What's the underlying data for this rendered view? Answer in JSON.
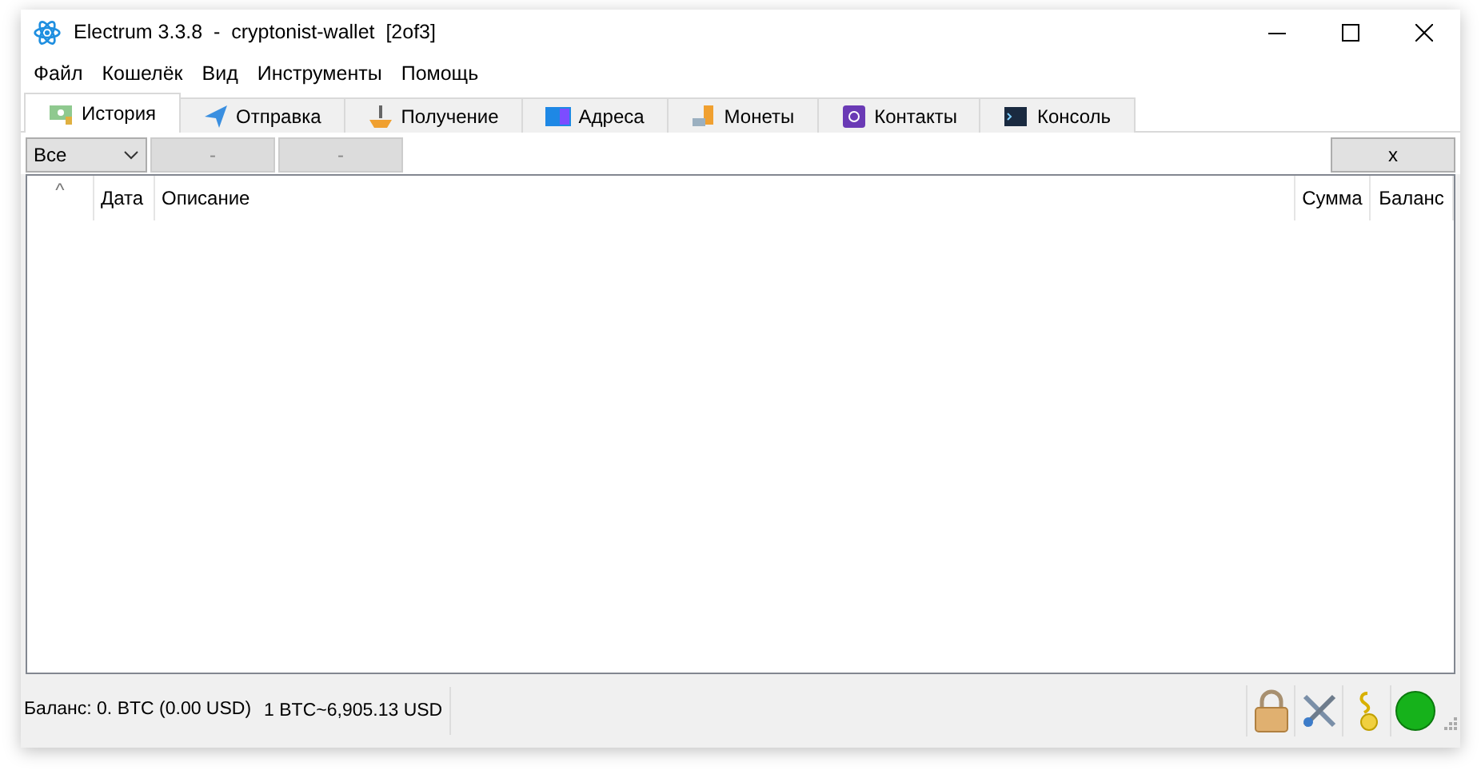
{
  "window": {
    "title": "Electrum 3.3.8  -  cryptonist-wallet  [2of3]"
  },
  "menu": [
    "Файл",
    "Кошелёк",
    "Вид",
    "Инструменты",
    "Помощь"
  ],
  "tabs": [
    {
      "label": "История",
      "kind": "history",
      "selected": true
    },
    {
      "label": "Отправка",
      "kind": "send",
      "selected": false
    },
    {
      "label": "Получение",
      "kind": "receive",
      "selected": false
    },
    {
      "label": "Адреса",
      "kind": "addresses",
      "selected": false
    },
    {
      "label": "Монеты",
      "kind": "coins",
      "selected": false
    },
    {
      "label": "Контакты",
      "kind": "contacts",
      "selected": false
    },
    {
      "label": "Консоль",
      "kind": "console",
      "selected": false
    }
  ],
  "toolbar": {
    "filter": "Все",
    "date_from": "-",
    "date_to": "-",
    "close": "x"
  },
  "table": {
    "sort_indicator": "^",
    "columns": [
      "Дата",
      "Описание",
      "Сумма",
      "Баланс"
    ]
  },
  "status_bar": {
    "balance": "Баланс: 0. BTC (0.00 USD)",
    "rate": "1 BTC~6,905.13 USD"
  }
}
